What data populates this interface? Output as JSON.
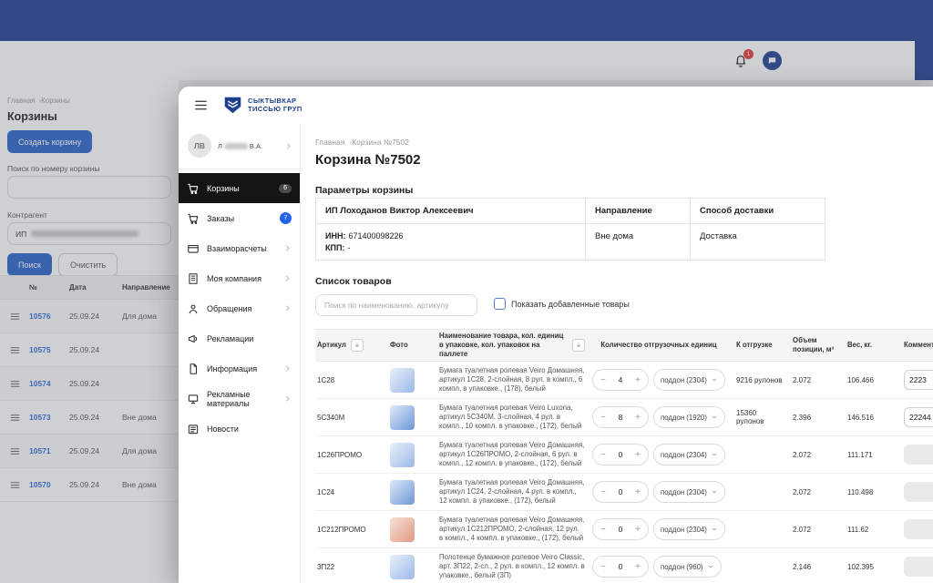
{
  "colors": {
    "brand_navy": "#1e3e8f",
    "accent_blue": "#2a63c9",
    "link_blue": "#2e6bd6",
    "badge_blue": "#2563eb",
    "badge_red": "#e23c32",
    "active_item_black": "#141414"
  },
  "icons": {
    "minus": "−",
    "plus": "+"
  },
  "topbar": {
    "bell_badge": "1"
  },
  "background_page": {
    "breadcrumb": {
      "home": "Главная",
      "current": "Корзины"
    },
    "title": "Корзины",
    "create_button": "Создать корзину",
    "search_label": "Поиск по номеру корзины",
    "contractor_label": "Контрагент",
    "contractor_prefix": "ИП",
    "search_button": "Поиск",
    "clear_button": "Очистить",
    "table": {
      "headers": {
        "num": "№",
        "date": "Дата",
        "direction": "Направление"
      },
      "rows": [
        {
          "num": "10576",
          "date": "25.09.24",
          "direction": "Для дома"
        },
        {
          "num": "10575",
          "date": "25.09.24",
          "direction": ""
        },
        {
          "num": "10574",
          "date": "25.09.24",
          "direction": ""
        },
        {
          "num": "10573",
          "date": "25.09.24",
          "direction": "Вне дома"
        },
        {
          "num": "10571",
          "date": "25.09.24",
          "direction": "Для дома"
        },
        {
          "num": "10570",
          "date": "25.09.24",
          "direction": "Вне дома"
        }
      ]
    }
  },
  "window": {
    "logo": {
      "line1": "СЫКТЫВКАР",
      "line2": "ТИССЬЮ ГРУП"
    },
    "user": {
      "initials": "ЛВ",
      "name_prefix": "Л",
      "name_suffix": "В.А."
    },
    "menu": [
      {
        "label": "Корзины",
        "badge": "6"
      },
      {
        "label": "Заказы",
        "badge": "7"
      },
      {
        "label": "Взаиморасчеты"
      },
      {
        "label": "Моя компания"
      },
      {
        "label": "Обращения"
      },
      {
        "label": "Рекламации"
      },
      {
        "label": "Информация"
      },
      {
        "label": "Рекламные материалы"
      },
      {
        "label": "Новости"
      }
    ],
    "breadcrumb": {
      "home": "Главная",
      "current": "Корзина №7502"
    },
    "page_title": "Корзина №7502",
    "params": {
      "title": "Параметры корзины",
      "client_name": "ИП Лоходанов Виктор Алексеевич",
      "inn_label": "ИНН:",
      "inn_value": "671400098226",
      "kpp_label": "КПП:",
      "kpp_value": "-",
      "direction_label": "Направление",
      "direction_value": "Вне дома",
      "delivery_label": "Способ доставки",
      "delivery_value": "Доставка"
    },
    "products": {
      "title": "Список товаров",
      "search_placeholder": "Поиск по наименованию, артикулу",
      "show_added_label": "Показать добавленные товары",
      "headers": {
        "article": "Артикул",
        "photo": "Фото",
        "name": "Наименование товара, кол. единиц в упаковке, кол. упаковок на паллете",
        "qty": "Количество отгрузочных единиц",
        "to_ship": "К отгрузке",
        "volume": "Объем позиции, м³",
        "weight": "Вес, кг.",
        "comment": "Комментарий"
      },
      "rows": [
        {
          "article": "1С28",
          "name": "Бумага туалетная ролевая Veiro Домашняя, артикул 1С28, 2-слойная, 8 рул. в компл., 6 компл. в упаковке., (178), белый",
          "qty": "4",
          "unit": "поддон (2304)",
          "to_ship": "9216 рулонов",
          "volume": "2.072",
          "weight": "106.466",
          "comment": "2223"
        },
        {
          "article": "5С340М",
          "name": "Бумага туалетная ролевая Veiro Luxoria, артикул 5С340М, 3-слойная, 4 рул. в компл., 10 компл. в упаковке., (172), белый",
          "qty": "8",
          "unit": "поддон (1920)",
          "to_ship": "15360 рулонов",
          "volume": "2.396",
          "weight": "146.516",
          "comment": "22244"
        },
        {
          "article": "1С26ПРОМО",
          "name": "Бумага туалетная ролевая Veiro Домашняя, артикул 1С26ПРОМО, 2-слойная, 6 рул. в компл., 12 компл. в упаковке., (172), белый",
          "qty": "0",
          "unit": "поддон (2304)",
          "to_ship": "",
          "volume": "2.072",
          "weight": "111.171",
          "comment": ""
        },
        {
          "article": "1С24",
          "name": "Бумага туалетная ролевая Veiro Домашняя, артикул 1С24, 2-слойная, 4 рул. в компл., 12 компл. в упаковке., (172), белый",
          "qty": "0",
          "unit": "поддон (2304)",
          "to_ship": "",
          "volume": "2.072",
          "weight": "110.498",
          "comment": ""
        },
        {
          "article": "1С212ПРОМО",
          "name": "Бумага туалетная ролевая Veiro Домашняя, артикул 1С212ПРОМО, 2-слойная, 12 рул. в компл., 4 компл. в упаковке., (172), белый",
          "qty": "0",
          "unit": "поддон (2304)",
          "to_ship": "",
          "volume": "2.072",
          "weight": "111.62",
          "comment": ""
        },
        {
          "article": "3П22",
          "name": "Полотенце бумажное ролевое Veiro Classic, арт. 3П22, 2-сл., 2 рул. в компл., 12 компл. в упаковке., белый (3П)",
          "qty": "0",
          "unit": "поддон (960)",
          "to_ship": "",
          "volume": "2.146",
          "weight": "102.395",
          "comment": ""
        }
      ]
    }
  }
}
